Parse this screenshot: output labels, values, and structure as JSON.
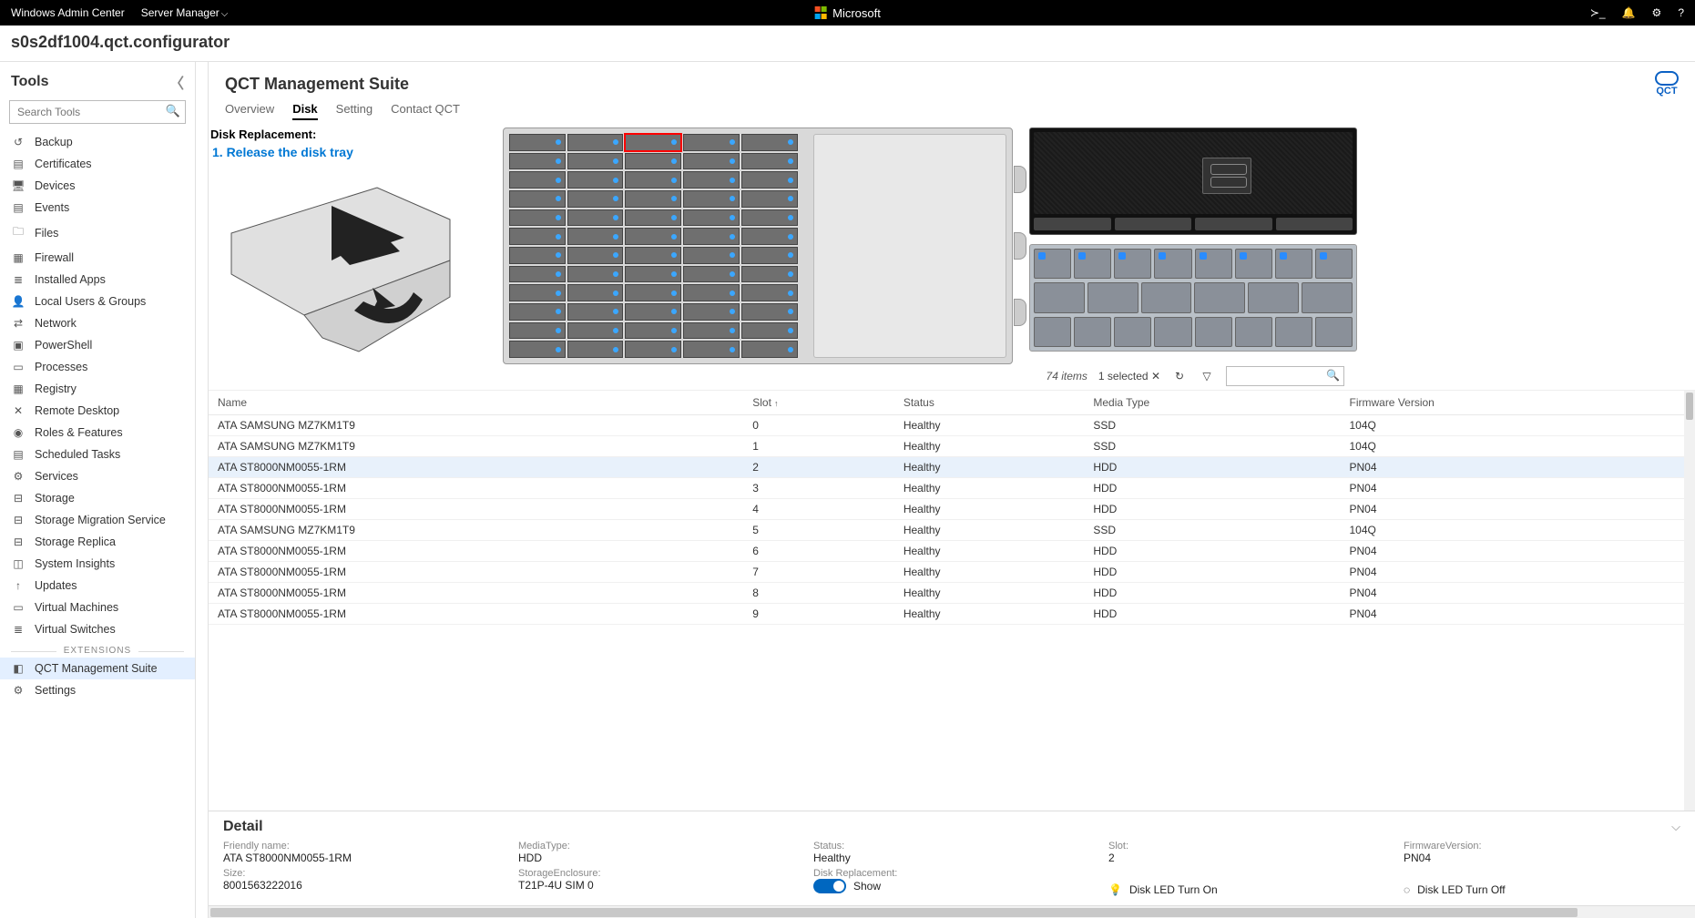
{
  "topbar": {
    "product": "Windows Admin Center",
    "menu": "Server Manager",
    "brand": "Microsoft"
  },
  "server_name": "s0s2df1004.qct.configurator",
  "sidebar": {
    "title": "Tools",
    "search_placeholder": "Search Tools",
    "items": [
      {
        "icon": "↺",
        "label": "Backup"
      },
      {
        "icon": "▤",
        "label": "Certificates"
      },
      {
        "icon": "🖥",
        "label": "Devices"
      },
      {
        "icon": "▤",
        "label": "Events"
      },
      {
        "icon": "🗀",
        "label": "Files"
      },
      {
        "icon": "▦",
        "label": "Firewall"
      },
      {
        "icon": "≣",
        "label": "Installed Apps"
      },
      {
        "icon": "👤",
        "label": "Local Users & Groups"
      },
      {
        "icon": "⇄",
        "label": "Network"
      },
      {
        "icon": "▣",
        "label": "PowerShell"
      },
      {
        "icon": "▭",
        "label": "Processes"
      },
      {
        "icon": "▦",
        "label": "Registry"
      },
      {
        "icon": "✕",
        "label": "Remote Desktop"
      },
      {
        "icon": "◉",
        "label": "Roles & Features"
      },
      {
        "icon": "▤",
        "label": "Scheduled Tasks"
      },
      {
        "icon": "⚙",
        "label": "Services"
      },
      {
        "icon": "⊟",
        "label": "Storage"
      },
      {
        "icon": "⊟",
        "label": "Storage Migration Service"
      },
      {
        "icon": "⊟",
        "label": "Storage Replica"
      },
      {
        "icon": "◫",
        "label": "System Insights"
      },
      {
        "icon": "↑",
        "label": "Updates"
      },
      {
        "icon": "▭",
        "label": "Virtual Machines"
      },
      {
        "icon": "≣",
        "label": "Virtual Switches"
      }
    ],
    "extensions_label": "EXTENSIONS",
    "ext_items": [
      {
        "icon": "◧",
        "label": "QCT Management Suite",
        "active": true
      },
      {
        "icon": "⚙",
        "label": "Settings"
      }
    ]
  },
  "main": {
    "title": "QCT Management Suite",
    "qct_label": "QCT",
    "tabs": [
      "Overview",
      "Disk",
      "Setting",
      "Contact QCT"
    ],
    "active_tab": 1,
    "disk_rep_heading": "Disk Replacement:",
    "disk_rep_step": "1. Release the disk tray"
  },
  "table": {
    "summary_items": "74 items",
    "summary_selected": "1 selected",
    "columns": [
      "Name",
      "Slot",
      "Status",
      "Media Type",
      "Firmware Version"
    ],
    "sort_col": 1,
    "sort_dir": "asc",
    "rows": [
      {
        "name": "ATA SAMSUNG MZ7KM1T9",
        "slot": "0",
        "status": "Healthy",
        "media": "SSD",
        "fw": "104Q"
      },
      {
        "name": "ATA SAMSUNG MZ7KM1T9",
        "slot": "1",
        "status": "Healthy",
        "media": "SSD",
        "fw": "104Q"
      },
      {
        "name": "ATA ST8000NM0055-1RM",
        "slot": "2",
        "status": "Healthy",
        "media": "HDD",
        "fw": "PN04",
        "selected": true
      },
      {
        "name": "ATA ST8000NM0055-1RM",
        "slot": "3",
        "status": "Healthy",
        "media": "HDD",
        "fw": "PN04"
      },
      {
        "name": "ATA ST8000NM0055-1RM",
        "slot": "4",
        "status": "Healthy",
        "media": "HDD",
        "fw": "PN04"
      },
      {
        "name": "ATA SAMSUNG MZ7KM1T9",
        "slot": "5",
        "status": "Healthy",
        "media": "SSD",
        "fw": "104Q"
      },
      {
        "name": "ATA ST8000NM0055-1RM",
        "slot": "6",
        "status": "Healthy",
        "media": "HDD",
        "fw": "PN04"
      },
      {
        "name": "ATA ST8000NM0055-1RM",
        "slot": "7",
        "status": "Healthy",
        "media": "HDD",
        "fw": "PN04"
      },
      {
        "name": "ATA ST8000NM0055-1RM",
        "slot": "8",
        "status": "Healthy",
        "media": "HDD",
        "fw": "PN04"
      },
      {
        "name": "ATA ST8000NM0055-1RM",
        "slot": "9",
        "status": "Healthy",
        "media": "HDD",
        "fw": "PN04"
      }
    ]
  },
  "detail": {
    "heading": "Detail",
    "labels": {
      "friendly": "Friendly name:",
      "media": "MediaType:",
      "status": "Status:",
      "slot": "Slot:",
      "fw": "FirmwareVersion:",
      "size": "Size:",
      "enclosure": "StorageEnclosure:",
      "replacement": "Disk Replacement:"
    },
    "values": {
      "friendly": "ATA ST8000NM0055-1RM",
      "media": "HDD",
      "status": "Healthy",
      "slot": "2",
      "fw": "PN04",
      "size": "8001563222016",
      "enclosure": "T21P-4U SIM 0",
      "replacement_toggle": "Show"
    },
    "led_on": "Disk LED Turn On",
    "led_off": "Disk LED Turn Off"
  }
}
